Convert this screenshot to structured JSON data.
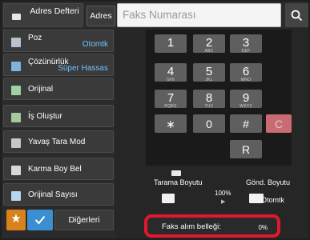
{
  "topbar": {
    "address_book_label": "Adres Defteri",
    "address_label": "Adres",
    "fax_placeholder": "Faks Numarası"
  },
  "left_menu": [
    {
      "label": "Poz",
      "value": "Otomtk"
    },
    {
      "label": "Çözünürlük",
      "value": "Süper Hassas"
    },
    {
      "label": "Orijinal",
      "value": ""
    },
    {
      "label": "İş Oluştur",
      "value": ""
    },
    {
      "label": "Yavaş Tara Mod",
      "value": ""
    },
    {
      "label": "Karma Boy Bel",
      "value": ""
    },
    {
      "label": "Orijinal Sayısı",
      "value": ""
    }
  ],
  "bottom": {
    "others_label": "Diğerleri"
  },
  "keypad": [
    {
      "num": "1",
      "sub": ""
    },
    {
      "num": "2",
      "sub": "ABC"
    },
    {
      "num": "3",
      "sub": "DEF"
    },
    {
      "num": "4",
      "sub": "GHI"
    },
    {
      "num": "5",
      "sub": "JKL"
    },
    {
      "num": "6",
      "sub": "MNO"
    },
    {
      "num": "7",
      "sub": "PQRS"
    },
    {
      "num": "8",
      "sub": "TUV"
    },
    {
      "num": "9",
      "sub": "WXYZ"
    },
    {
      "num": "∗",
      "sub": ""
    },
    {
      "num": "0",
      "sub": ""
    },
    {
      "num": "#",
      "sub": ""
    },
    {
      "num": "C",
      "sub": ""
    },
    {
      "num": "R",
      "sub": ""
    }
  ],
  "scan": {
    "scan_size_label": "Tarama Boyutu",
    "send_size_label": "Gönd. Boyutu",
    "ratio": "100%",
    "send_value": "Otomtk"
  },
  "memory": {
    "label": "Faks alım belleği:",
    "value": "0%"
  },
  "colors": {
    "accent_blue": "#3b8fd1",
    "favorite_orange": "#d9821d",
    "highlight_red": "#e0182d"
  }
}
